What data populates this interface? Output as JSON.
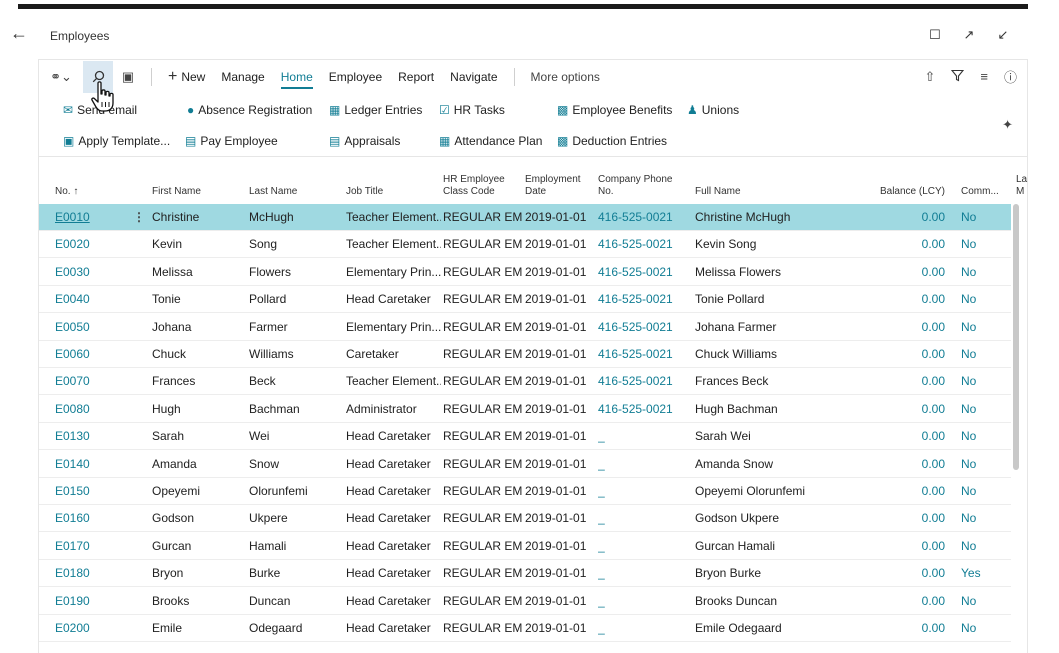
{
  "page": {
    "title": "Employees"
  },
  "actionbar": {
    "new_label": "New",
    "items": [
      "Manage",
      "Home",
      "Employee",
      "Report",
      "Navigate"
    ],
    "more_label": "More options"
  },
  "promoted": {
    "row1": [
      "Send email",
      "Absence Registration",
      "Ledger Entries",
      "HR Tasks",
      "Employee Benefits",
      "Unions"
    ],
    "row2": [
      "Apply Template...",
      "Pay Employee",
      "Appraisals",
      "Attendance Plan",
      "Deduction Entries"
    ]
  },
  "columns": {
    "no": "No. ↑",
    "first_name": "First Name",
    "last_name": "Last Name",
    "job_title": "Job Title",
    "class_code_1": "HR Employee",
    "class_code_2": "Class Code",
    "emp_date_1": "Employment",
    "emp_date_2": "Date",
    "phone_1": "Company Phone",
    "phone_2": "No.",
    "full_name": "Full Name",
    "balance": "Balance (LCY)",
    "comm": "Comm...",
    "extra_1": "La",
    "extra_2": "M"
  },
  "rows": [
    {
      "no": "E0010",
      "first": "Christine",
      "last": "McHugh",
      "job": "Teacher Element...",
      "cls": "REGULAR EM...",
      "date": "2019-01-01",
      "phone": "416-525-0021",
      "full": "Christine McHugh",
      "bal": "0.00",
      "comm": "No"
    },
    {
      "no": "E0020",
      "first": "Kevin",
      "last": "Song",
      "job": "Teacher Element...",
      "cls": "REGULAR EM...",
      "date": "2019-01-01",
      "phone": "416-525-0021",
      "full": "Kevin Song",
      "bal": "0.00",
      "comm": "No"
    },
    {
      "no": "E0030",
      "first": "Melissa",
      "last": "Flowers",
      "job": "Elementary Prin...",
      "cls": "REGULAR EM...",
      "date": "2019-01-01",
      "phone": "416-525-0021",
      "full": "Melissa Flowers",
      "bal": "0.00",
      "comm": "No"
    },
    {
      "no": "E0040",
      "first": "Tonie",
      "last": "Pollard",
      "job": "Head Caretaker",
      "cls": "REGULAR EM...",
      "date": "2019-01-01",
      "phone": "416-525-0021",
      "full": "Tonie Pollard",
      "bal": "0.00",
      "comm": "No"
    },
    {
      "no": "E0050",
      "first": "Johana",
      "last": "Farmer",
      "job": "Elementary Prin...",
      "cls": "REGULAR EM...",
      "date": "2019-01-01",
      "phone": "416-525-0021",
      "full": "Johana Farmer",
      "bal": "0.00",
      "comm": "No"
    },
    {
      "no": "E0060",
      "first": "Chuck",
      "last": "Williams",
      "job": "Caretaker",
      "cls": "REGULAR EM...",
      "date": "2019-01-01",
      "phone": "416-525-0021",
      "full": "Chuck Williams",
      "bal": "0.00",
      "comm": "No"
    },
    {
      "no": "E0070",
      "first": "Frances",
      "last": "Beck",
      "job": "Teacher Element...",
      "cls": "REGULAR EM...",
      "date": "2019-01-01",
      "phone": "416-525-0021",
      "full": "Frances Beck",
      "bal": "0.00",
      "comm": "No"
    },
    {
      "no": "E0080",
      "first": "Hugh",
      "last": "Bachman",
      "job": "Administrator",
      "cls": "REGULAR EM...",
      "date": "2019-01-01",
      "phone": "416-525-0021",
      "full": "Hugh Bachman",
      "bal": "0.00",
      "comm": "No"
    },
    {
      "no": "E0130",
      "first": "Sarah",
      "last": "Wei",
      "job": "Head Caretaker",
      "cls": "REGULAR EM...",
      "date": "2019-01-01",
      "phone": "_",
      "full": "Sarah Wei",
      "bal": "0.00",
      "comm": "No"
    },
    {
      "no": "E0140",
      "first": "Amanda",
      "last": "Snow",
      "job": "Head Caretaker",
      "cls": "REGULAR EM...",
      "date": "2019-01-01",
      "phone": "_",
      "full": "Amanda Snow",
      "bal": "0.00",
      "comm": "No"
    },
    {
      "no": "E0150",
      "first": "Opeyemi",
      "last": "Olorunfemi",
      "job": "Head Caretaker",
      "cls": "REGULAR EM...",
      "date": "2019-01-01",
      "phone": "_",
      "full": "Opeyemi Olorunfemi",
      "bal": "0.00",
      "comm": "No"
    },
    {
      "no": "E0160",
      "first": "Godson",
      "last": "Ukpere",
      "job": "Head Caretaker",
      "cls": "REGULAR EM...",
      "date": "2019-01-01",
      "phone": "_",
      "full": "Godson Ukpere",
      "bal": "0.00",
      "comm": "No"
    },
    {
      "no": "E0170",
      "first": "Gurcan",
      "last": "Hamali",
      "job": "Head Caretaker",
      "cls": "REGULAR EM...",
      "date": "2019-01-01",
      "phone": "_",
      "full": "Gurcan Hamali",
      "bal": "0.00",
      "comm": "No"
    },
    {
      "no": "E0180",
      "first": "Bryon",
      "last": "Burke",
      "job": "Head Caretaker",
      "cls": "REGULAR EM...",
      "date": "2019-01-01",
      "phone": "_",
      "full": "Bryon Burke",
      "bal": "0.00",
      "comm": "Yes"
    },
    {
      "no": "E0190",
      "first": "Brooks",
      "last": "Duncan",
      "job": "Head Caretaker",
      "cls": "REGULAR EM...",
      "date": "2019-01-01",
      "phone": "_",
      "full": "Brooks Duncan",
      "bal": "0.00",
      "comm": "No"
    },
    {
      "no": "E0200",
      "first": "Emile",
      "last": "Odegaard",
      "job": "Head Caretaker",
      "cls": "REGULAR EM...",
      "date": "2019-01-01",
      "phone": "_",
      "full": "Emile Odegaard",
      "bal": "0.00",
      "comm": "No"
    }
  ],
  "colors": {
    "accent": "#117d94",
    "selected_row": "#9fd9e1",
    "tab_active_bg": "#dbe8f2"
  },
  "icons": {
    "back": "back-arrow-icon",
    "bookmark": "bookmark-icon",
    "open_new": "open-new-window-icon",
    "collapse": "collapse-icon"
  }
}
